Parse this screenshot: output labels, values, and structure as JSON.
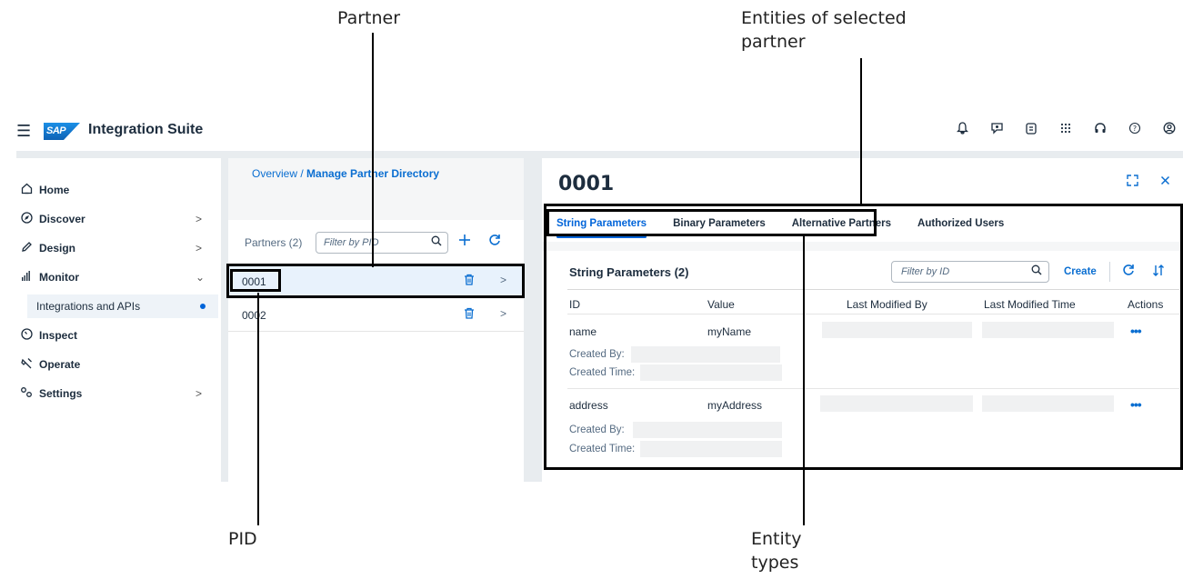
{
  "annotations": {
    "partner": "Partner",
    "entities_line1": "Entities of selected",
    "entities_line2": "partner",
    "pid": "PID",
    "entity_types_line1": "Entity",
    "entity_types_line2": "types"
  },
  "shell": {
    "menu_icon": "hamburger-icon",
    "logo_text": "SAP",
    "title": "Integration Suite",
    "icons": [
      "bell-icon",
      "feedback-icon",
      "copilot-icon",
      "grid-icon",
      "headset-icon",
      "help-icon",
      "user-icon"
    ]
  },
  "nav": {
    "items": [
      {
        "label": "Home",
        "icon": "home-icon",
        "chevron": ""
      },
      {
        "label": "Discover",
        "icon": "compass-icon",
        "chevron": ">"
      },
      {
        "label": "Design",
        "icon": "pencil-icon",
        "chevron": ">"
      },
      {
        "label": "Monitor",
        "icon": "bar-chart-icon",
        "chevron": "⌄"
      },
      {
        "label": "Inspect",
        "icon": "gauge-icon",
        "chevron": ""
      },
      {
        "label": "Operate",
        "icon": "wrench-icon",
        "chevron": ""
      },
      {
        "label": "Settings",
        "icon": "gears-icon",
        "chevron": ">"
      }
    ],
    "sub_item": "Integrations and APIs"
  },
  "breadcrumb": {
    "overview": "Overview",
    "separator": " / ",
    "current": "Manage Partner Directory"
  },
  "partners": {
    "label": "Partners (2)",
    "filter_placeholder": "Filter by PID",
    "rows": [
      {
        "pid": "0001",
        "selected": true
      },
      {
        "pid": "0002",
        "selected": false
      }
    ]
  },
  "detail": {
    "title": "0001",
    "tabs": [
      "String Parameters",
      "Binary Parameters",
      "Alternative Partners",
      "Authorized Users"
    ],
    "active_tab": "String Parameters",
    "card": {
      "title": "String Parameters (2)",
      "filter_placeholder": "Filter by ID",
      "create_label": "Create",
      "columns": [
        "ID",
        "Value",
        "Last Modified By",
        "Last Modified Time",
        "Actions"
      ],
      "rows": [
        {
          "id": "name",
          "value": "myName",
          "created_by_label": "Created By:",
          "created_time_label": "Created Time:"
        },
        {
          "id": "address",
          "value": "myAddress",
          "created_by_label": "Created By:",
          "created_time_label": "Created Time:"
        }
      ],
      "actions_glyph": "•••"
    }
  },
  "colors": {
    "accent": "#0a6ed1",
    "selected_row": "#e8f2fc",
    "shell_gutter": "#e8ecef"
  }
}
